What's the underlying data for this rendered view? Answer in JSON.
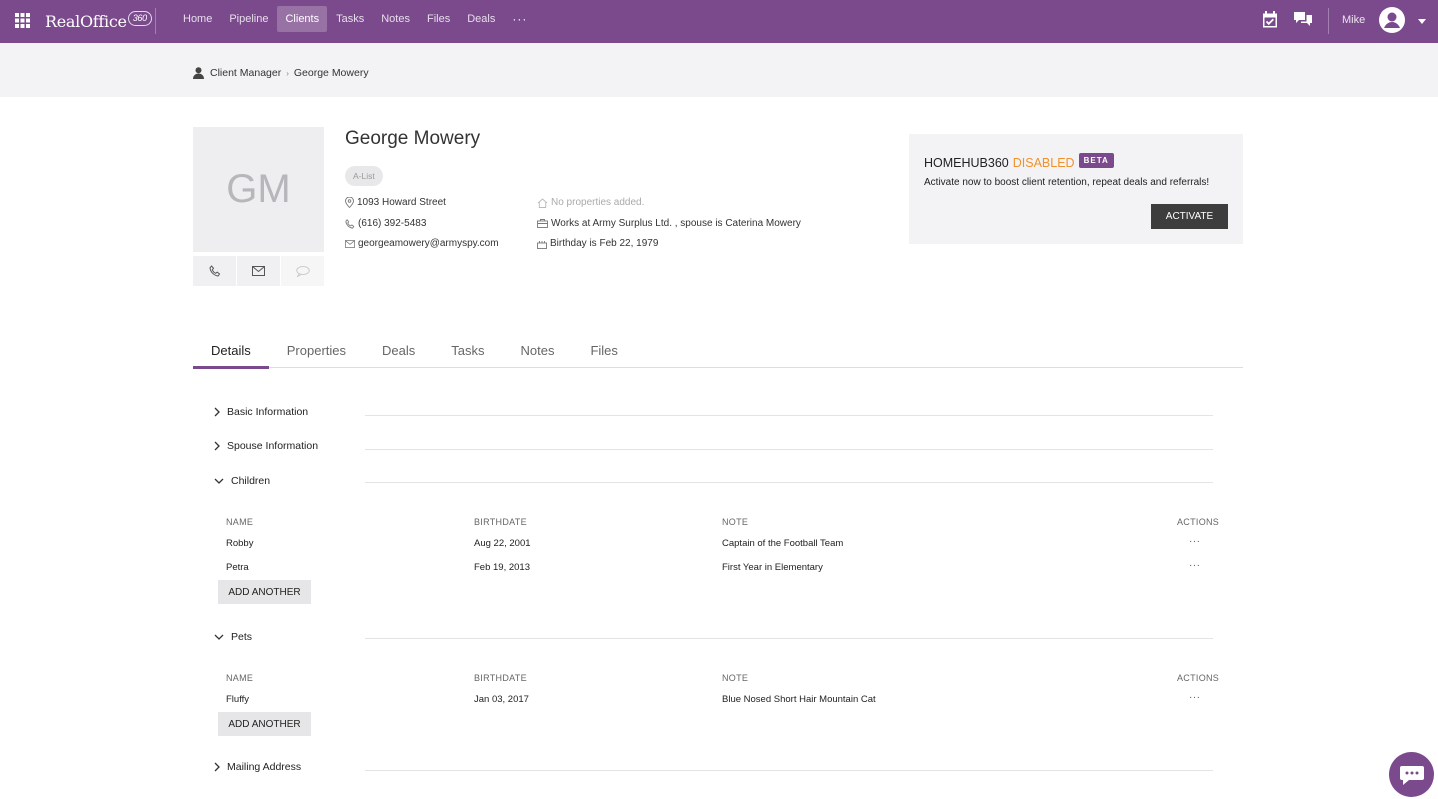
{
  "app": {
    "logo_text": "RealOffice",
    "logo_badge": "360"
  },
  "nav": [
    {
      "label": "Home",
      "active": false
    },
    {
      "label": "Pipeline",
      "active": false
    },
    {
      "label": "Clients",
      "active": true
    },
    {
      "label": "Tasks",
      "active": false
    },
    {
      "label": "Notes",
      "active": false
    },
    {
      "label": "Files",
      "active": false
    },
    {
      "label": "Deals",
      "active": false
    }
  ],
  "nav_more": "···",
  "user": {
    "name": "Mike"
  },
  "breadcrumb": {
    "root": "Client Manager",
    "separator": "›",
    "current": "George Mowery"
  },
  "client": {
    "initials": "GM",
    "name": "George Mowery",
    "tag": "A-List",
    "address": "1093 Howard Street",
    "phone": "(616) 392-5483",
    "email": "georgeamowery@armyspy.com",
    "properties": "No properties added.",
    "work": "Works at Army Surplus Ltd. , spouse is Caterina Mowery",
    "birthday": "Birthday is Feb 22, 1979"
  },
  "homehub": {
    "title": "HOMEHUB360",
    "status": "DISABLED",
    "badge": "BETA",
    "description": "Activate now to boost client retention, repeat deals and referrals!",
    "button": "ACTIVATE"
  },
  "tabs": [
    {
      "label": "Details",
      "active": true
    },
    {
      "label": "Properties",
      "active": false
    },
    {
      "label": "Deals",
      "active": false
    },
    {
      "label": "Tasks",
      "active": false
    },
    {
      "label": "Notes",
      "active": false
    },
    {
      "label": "Files",
      "active": false
    }
  ],
  "sections": {
    "basic": "Basic Information",
    "spouse": "Spouse Information",
    "children": "Children",
    "pets": "Pets",
    "mailing": "Mailing Address"
  },
  "columns": {
    "name": "NAME",
    "birthdate": "BIRTHDATE",
    "note": "NOTE",
    "actions": "ACTIONS"
  },
  "children": [
    {
      "name": "Robby",
      "birthdate": "Aug 22, 2001",
      "note": "Captain of the Football Team",
      "menu": "···"
    },
    {
      "name": "Petra",
      "birthdate": "Feb 19, 2013",
      "note": "First Year in Elementary",
      "menu": "···"
    }
  ],
  "pets": [
    {
      "name": "Fluffy",
      "birthdate": "Jan 03, 2017",
      "note": "Blue Nosed Short Hair Mountain Cat",
      "menu": "···"
    }
  ],
  "add_another_label": "ADD ANOTHER",
  "colors": {
    "brand": "#7b4a8c",
    "status_disabled": "#f0922b"
  },
  "icons": [
    "apps-grid-icon",
    "calendar-check-icon",
    "chat-bubbles-icon",
    "user-avatar-icon",
    "caret-down-icon",
    "person-icon",
    "map-pin-icon",
    "phone-icon",
    "mail-icon",
    "home-icon",
    "briefcase-icon",
    "cake-icon",
    "sms-icon",
    "chevron-right-icon",
    "chevron-down-icon",
    "chat-fab-icon"
  ]
}
